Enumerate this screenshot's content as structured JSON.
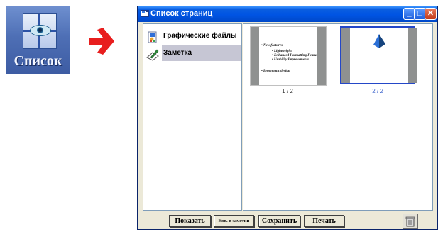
{
  "tile": {
    "label": "Список",
    "icon": "list-eye-icon"
  },
  "arrow": {
    "icon": "red-arrow-right-icon",
    "color": "#e81e1e"
  },
  "window": {
    "title": "Список страниц",
    "controls": {
      "minimize": "_",
      "maximize": "□",
      "close": "✕"
    }
  },
  "list": {
    "items": [
      {
        "label": "Графические файлы",
        "icon": "graphics-files-icon",
        "selected": false
      },
      {
        "label": "Заметка",
        "icon": "note-pen-icon",
        "selected": true
      }
    ]
  },
  "thumbnails": [
    {
      "caption": "1 / 2",
      "selected": false,
      "lines": [
        "• New features",
        "• Lightweight",
        "• Enhanced Formatting Features",
        "• Usability Improvements",
        "• Ergonomic design"
      ]
    },
    {
      "caption": "2 / 2",
      "selected": true,
      "content_icon": "pyramid-icon"
    }
  ],
  "toolbar": {
    "show": "Показать",
    "copy_to_note": "Коп. в заметки",
    "save": "Сохранить",
    "print": "Печать",
    "trash_icon": "trash-can-icon"
  }
}
